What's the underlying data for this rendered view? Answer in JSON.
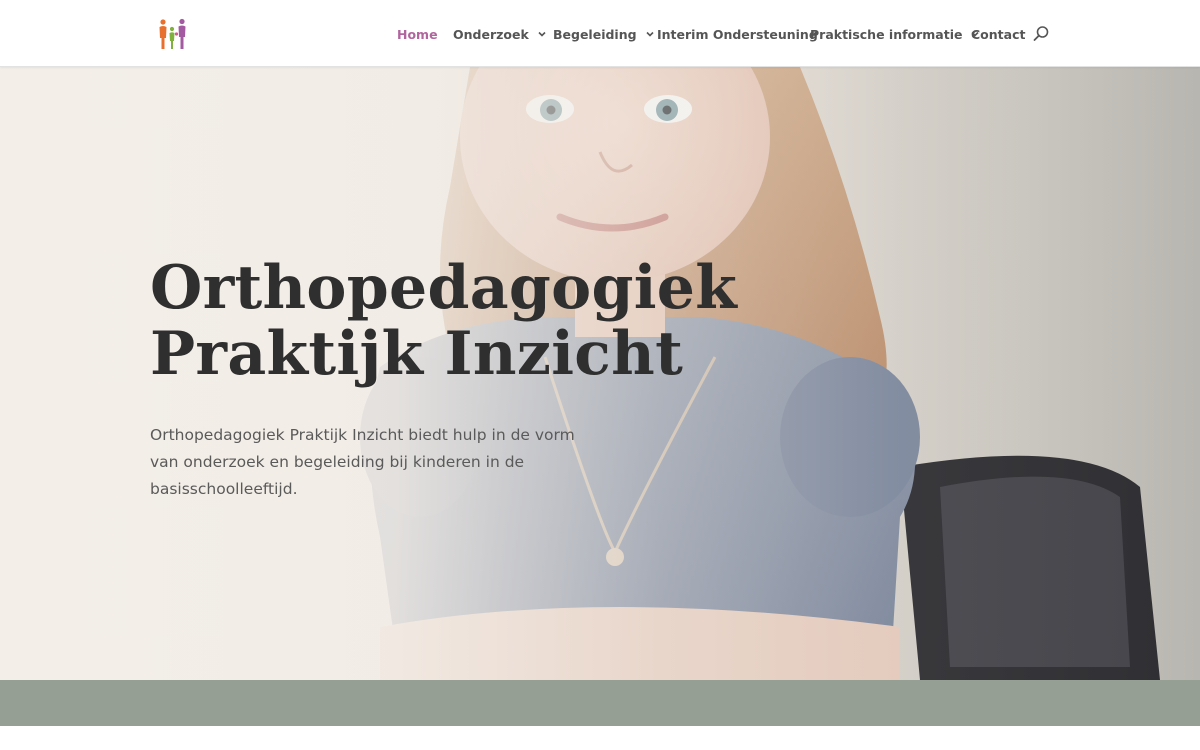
{
  "header": {
    "logo_icon": "family-figures-icon",
    "nav": [
      {
        "label": "Home",
        "active": true,
        "dropdown": false
      },
      {
        "label": "Onderzoek",
        "active": false,
        "dropdown": true
      },
      {
        "label": "Begeleiding",
        "active": false,
        "dropdown": true
      },
      {
        "label": "Interim Ondersteuning",
        "active": false,
        "dropdown": false
      },
      {
        "label": "Praktische informatie",
        "active": false,
        "dropdown": true
      },
      {
        "label": "Contact",
        "active": false,
        "dropdown": false
      }
    ],
    "search_icon": "search-icon"
  },
  "hero": {
    "title": "Orthopedagogiek Praktijk Inzicht",
    "text": "Orthopedagogiek Praktijk Inzicht biedt hulp in de vorm van onderzoek en begeleiding bij kinderen in de basisschoolleeftijd.",
    "background": "photo-of-girl"
  },
  "colors": {
    "accent": "#b1659e",
    "nav_text": "#555555",
    "band": "#969f94",
    "title": "#2f2f2f"
  }
}
